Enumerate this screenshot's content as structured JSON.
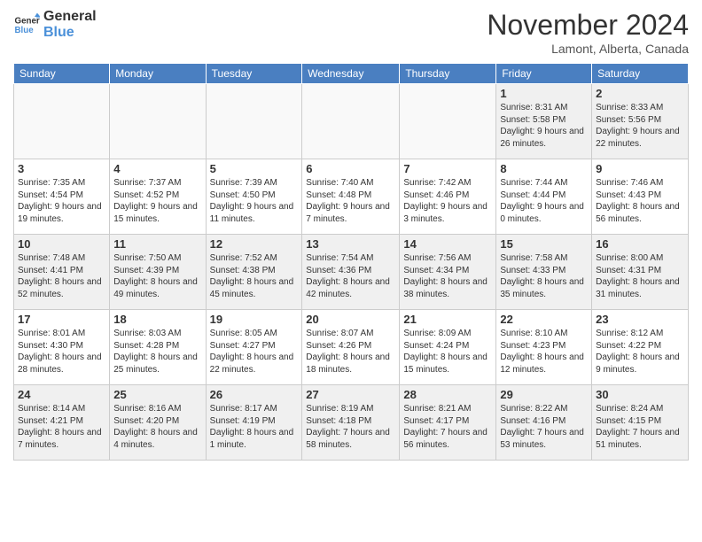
{
  "header": {
    "logo": {
      "general": "General",
      "blue": "Blue"
    },
    "title": "November 2024",
    "location": "Lamont, Alberta, Canada"
  },
  "weekdays": [
    "Sunday",
    "Monday",
    "Tuesday",
    "Wednesday",
    "Thursday",
    "Friday",
    "Saturday"
  ],
  "weeks": [
    [
      {
        "day": "",
        "info": ""
      },
      {
        "day": "",
        "info": ""
      },
      {
        "day": "",
        "info": ""
      },
      {
        "day": "",
        "info": ""
      },
      {
        "day": "",
        "info": ""
      },
      {
        "day": "1",
        "info": "Sunrise: 8:31 AM\nSunset: 5:58 PM\nDaylight: 9 hours and 26 minutes."
      },
      {
        "day": "2",
        "info": "Sunrise: 8:33 AM\nSunset: 5:56 PM\nDaylight: 9 hours and 22 minutes."
      }
    ],
    [
      {
        "day": "3",
        "info": "Sunrise: 7:35 AM\nSunset: 4:54 PM\nDaylight: 9 hours and 19 minutes."
      },
      {
        "day": "4",
        "info": "Sunrise: 7:37 AM\nSunset: 4:52 PM\nDaylight: 9 hours and 15 minutes."
      },
      {
        "day": "5",
        "info": "Sunrise: 7:39 AM\nSunset: 4:50 PM\nDaylight: 9 hours and 11 minutes."
      },
      {
        "day": "6",
        "info": "Sunrise: 7:40 AM\nSunset: 4:48 PM\nDaylight: 9 hours and 7 minutes."
      },
      {
        "day": "7",
        "info": "Sunrise: 7:42 AM\nSunset: 4:46 PM\nDaylight: 9 hours and 3 minutes."
      },
      {
        "day": "8",
        "info": "Sunrise: 7:44 AM\nSunset: 4:44 PM\nDaylight: 9 hours and 0 minutes."
      },
      {
        "day": "9",
        "info": "Sunrise: 7:46 AM\nSunset: 4:43 PM\nDaylight: 8 hours and 56 minutes."
      }
    ],
    [
      {
        "day": "10",
        "info": "Sunrise: 7:48 AM\nSunset: 4:41 PM\nDaylight: 8 hours and 52 minutes."
      },
      {
        "day": "11",
        "info": "Sunrise: 7:50 AM\nSunset: 4:39 PM\nDaylight: 8 hours and 49 minutes."
      },
      {
        "day": "12",
        "info": "Sunrise: 7:52 AM\nSunset: 4:38 PM\nDaylight: 8 hours and 45 minutes."
      },
      {
        "day": "13",
        "info": "Sunrise: 7:54 AM\nSunset: 4:36 PM\nDaylight: 8 hours and 42 minutes."
      },
      {
        "day": "14",
        "info": "Sunrise: 7:56 AM\nSunset: 4:34 PM\nDaylight: 8 hours and 38 minutes."
      },
      {
        "day": "15",
        "info": "Sunrise: 7:58 AM\nSunset: 4:33 PM\nDaylight: 8 hours and 35 minutes."
      },
      {
        "day": "16",
        "info": "Sunrise: 8:00 AM\nSunset: 4:31 PM\nDaylight: 8 hours and 31 minutes."
      }
    ],
    [
      {
        "day": "17",
        "info": "Sunrise: 8:01 AM\nSunset: 4:30 PM\nDaylight: 8 hours and 28 minutes."
      },
      {
        "day": "18",
        "info": "Sunrise: 8:03 AM\nSunset: 4:28 PM\nDaylight: 8 hours and 25 minutes."
      },
      {
        "day": "19",
        "info": "Sunrise: 8:05 AM\nSunset: 4:27 PM\nDaylight: 8 hours and 22 minutes."
      },
      {
        "day": "20",
        "info": "Sunrise: 8:07 AM\nSunset: 4:26 PM\nDaylight: 8 hours and 18 minutes."
      },
      {
        "day": "21",
        "info": "Sunrise: 8:09 AM\nSunset: 4:24 PM\nDaylight: 8 hours and 15 minutes."
      },
      {
        "day": "22",
        "info": "Sunrise: 8:10 AM\nSunset: 4:23 PM\nDaylight: 8 hours and 12 minutes."
      },
      {
        "day": "23",
        "info": "Sunrise: 8:12 AM\nSunset: 4:22 PM\nDaylight: 8 hours and 9 minutes."
      }
    ],
    [
      {
        "day": "24",
        "info": "Sunrise: 8:14 AM\nSunset: 4:21 PM\nDaylight: 8 hours and 7 minutes."
      },
      {
        "day": "25",
        "info": "Sunrise: 8:16 AM\nSunset: 4:20 PM\nDaylight: 8 hours and 4 minutes."
      },
      {
        "day": "26",
        "info": "Sunrise: 8:17 AM\nSunset: 4:19 PM\nDaylight: 8 hours and 1 minute."
      },
      {
        "day": "27",
        "info": "Sunrise: 8:19 AM\nSunset: 4:18 PM\nDaylight: 7 hours and 58 minutes."
      },
      {
        "day": "28",
        "info": "Sunrise: 8:21 AM\nSunset: 4:17 PM\nDaylight: 7 hours and 56 minutes."
      },
      {
        "day": "29",
        "info": "Sunrise: 8:22 AM\nSunset: 4:16 PM\nDaylight: 7 hours and 53 minutes."
      },
      {
        "day": "30",
        "info": "Sunrise: 8:24 AM\nSunset: 4:15 PM\nDaylight: 7 hours and 51 minutes."
      }
    ]
  ]
}
